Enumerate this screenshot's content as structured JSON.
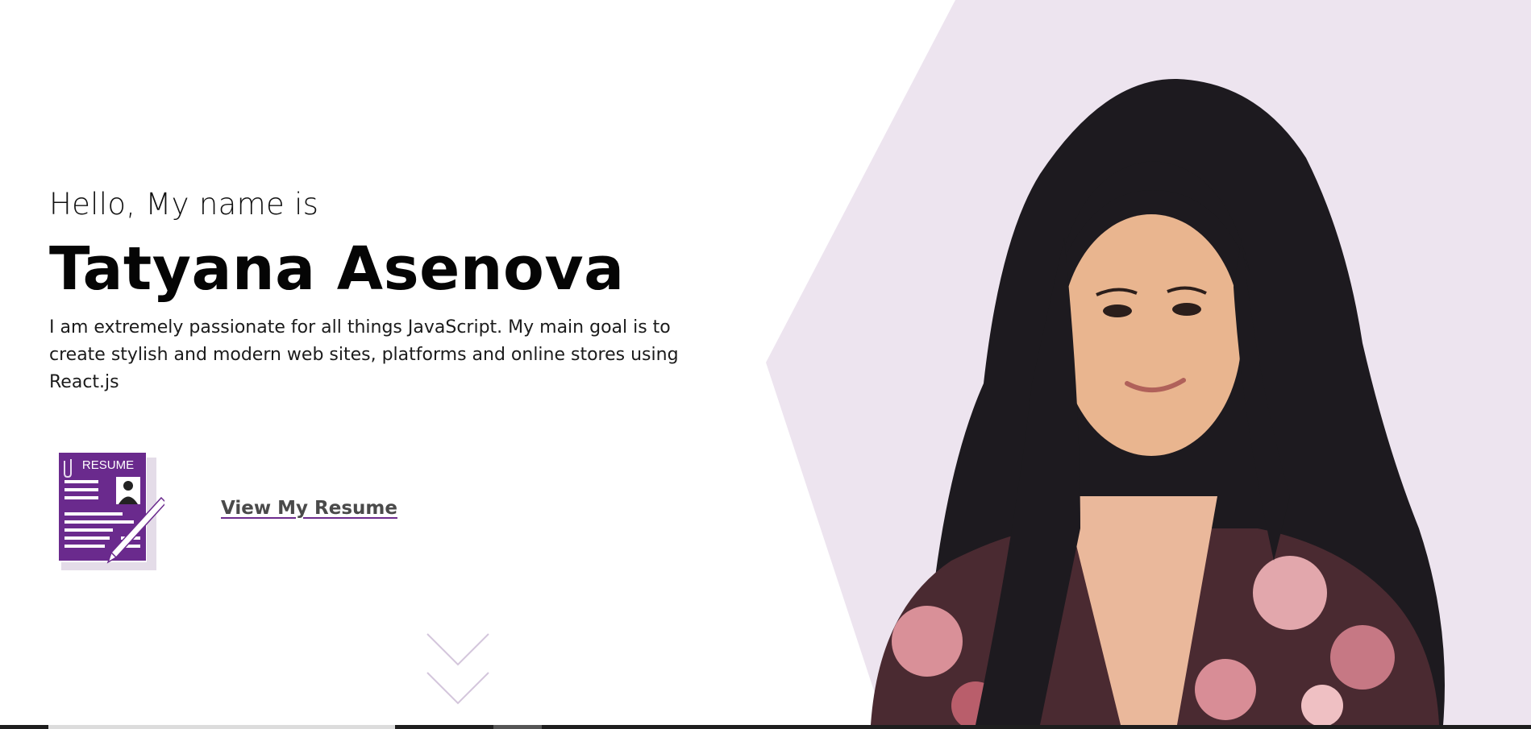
{
  "hero": {
    "greeting": "Hello, My name is",
    "name": "Tatyana Asenova",
    "bio": "I am extremely passionate for all things JavaScript. My main goal is to create stylish and modern web sites, platforms and online stores using React.js"
  },
  "resume": {
    "icon_label": "RESUME",
    "link_label": "View My Resume"
  },
  "icons": {
    "resume": "resume-document-icon",
    "scroll": "double-chevron-down-icon"
  },
  "colors": {
    "accent_purple": "#6d2c8d",
    "panel_lavender": "#ede4ef",
    "text_dark": "#050505"
  }
}
